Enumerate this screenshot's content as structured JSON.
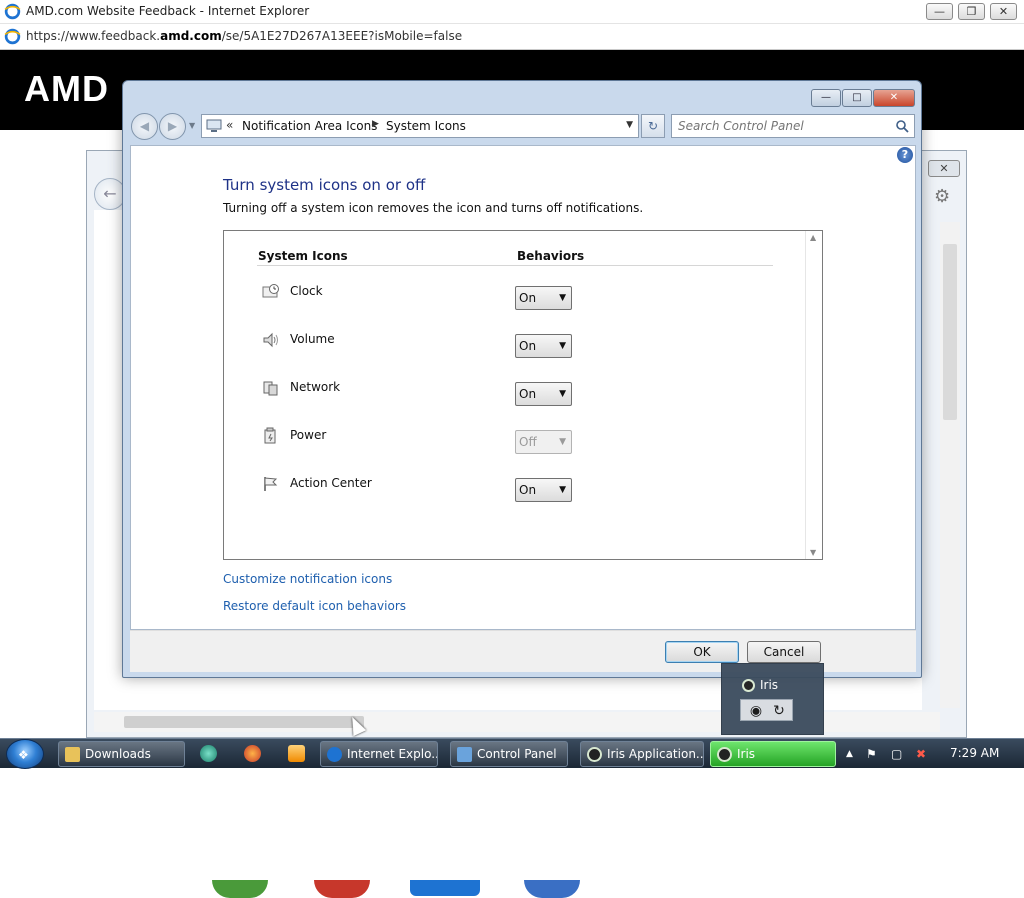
{
  "ie": {
    "title": "AMD.com Website Feedback - Internet Explorer",
    "url_prefix": "https://www.feedback.",
    "url_domain": "amd.com",
    "url_suffix": "/se/5A1E27D267A13EEE?isMobile=false",
    "brand": "AMD"
  },
  "dialog": {
    "breadcrumb": [
      "Notification Area Icons",
      "System Icons"
    ],
    "search_placeholder": "Search Control Panel",
    "title": "Turn system icons on or off",
    "description": "Turning off a system icon removes the icon and turns off notifications.",
    "col_icons": "System Icons",
    "col_behaviors": "Behaviors",
    "rows": [
      {
        "label": "Clock",
        "value": "On",
        "icon": "clock-icon",
        "enabled": true
      },
      {
        "label": "Volume",
        "value": "On",
        "icon": "volume-icon",
        "enabled": true
      },
      {
        "label": "Network",
        "value": "On",
        "icon": "network-icon",
        "enabled": true
      },
      {
        "label": "Power",
        "value": "Off",
        "icon": "power-icon",
        "enabled": false
      },
      {
        "label": "Action Center",
        "value": "On",
        "icon": "flag-icon",
        "enabled": true
      }
    ],
    "link_customize": "Customize notification icons",
    "link_restore": "Restore default icon behaviors",
    "ok": "OK",
    "cancel": "Cancel"
  },
  "iris_popup": {
    "name": "Iris"
  },
  "taskbar": {
    "items": [
      {
        "label": "Downloads"
      },
      {
        "label": "Internet Explo..."
      },
      {
        "label": "Control Panel"
      },
      {
        "label": "Iris Application..."
      },
      {
        "label": "Iris"
      }
    ],
    "clock": "7:29 AM"
  },
  "colors": {
    "accent_title": "#1e3287",
    "link": "#1e5fae",
    "taskbar_active": "#24a324"
  }
}
